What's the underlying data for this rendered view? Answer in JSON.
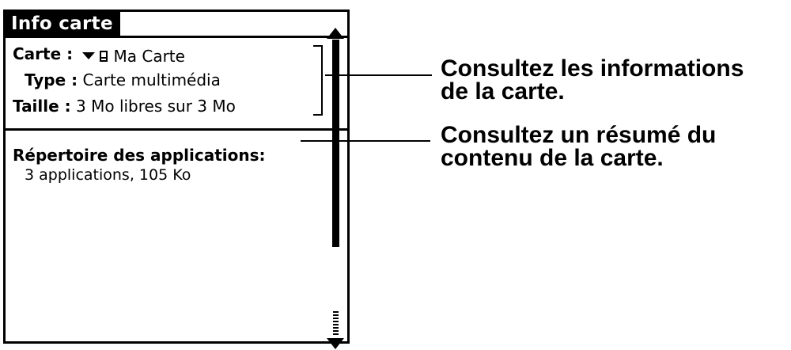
{
  "window": {
    "title": "Info carte"
  },
  "info": {
    "card_label": "Carte :",
    "card_value": "Ma Carte",
    "type_label": "Type :",
    "type_value": "Carte multimédia",
    "size_label": "Taille :",
    "size_value": "3 Mo libres sur 3 Mo"
  },
  "contents": {
    "directory_title": "Répertoire des applications:",
    "directory_detail": "3 applications, 105 Ko"
  },
  "callouts": {
    "info_line1": "Consultez les informations",
    "info_line2": "de la carte.",
    "summary_line1": "Consultez un résumé du",
    "summary_line2": "contenu de la carte."
  },
  "icons": [
    "dropdown-triangle-icon",
    "card-icon",
    "scroll-up-icon",
    "scroll-down-icon"
  ]
}
